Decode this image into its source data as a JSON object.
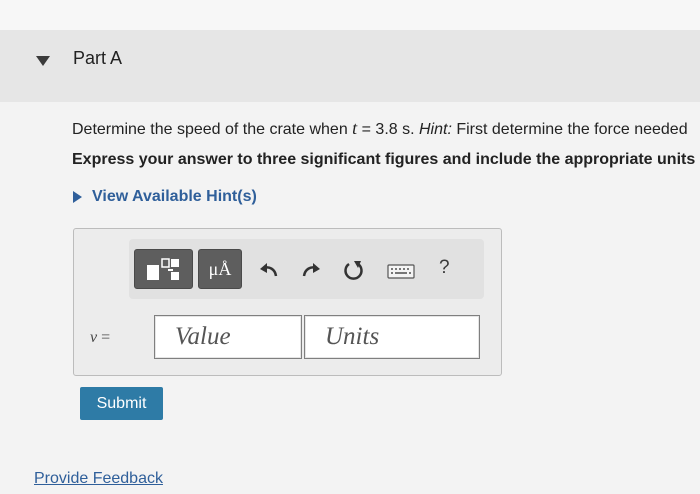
{
  "part": {
    "title": "Part A"
  },
  "question": {
    "prefix": "Determine the speed of the crate when ",
    "var": "t",
    "condition": " = 3.8 s. ",
    "hint_label": "Hint:",
    "hint_text": " First determine the force needed"
  },
  "instruction": "Express your answer to three significant figures and include the appropriate units",
  "hints": {
    "label": "View Available Hint(s)"
  },
  "toolbar": {
    "symbols_label": "μÅ",
    "help_label": "?",
    "icons": [
      "templates-icon",
      "undo-icon",
      "redo-icon",
      "reset-icon",
      "keyboard-icon",
      "help-icon"
    ]
  },
  "answer": {
    "variable": "v",
    "equals": " =",
    "value_placeholder": "Value",
    "units_placeholder": "Units"
  },
  "submit": {
    "label": "Submit"
  },
  "feedback": {
    "label": "Provide Feedback"
  },
  "colors": {
    "link": "#2f5f9a",
    "submit_bg": "#2e7ba6",
    "toolbar_dark": "#5e5e5e"
  }
}
